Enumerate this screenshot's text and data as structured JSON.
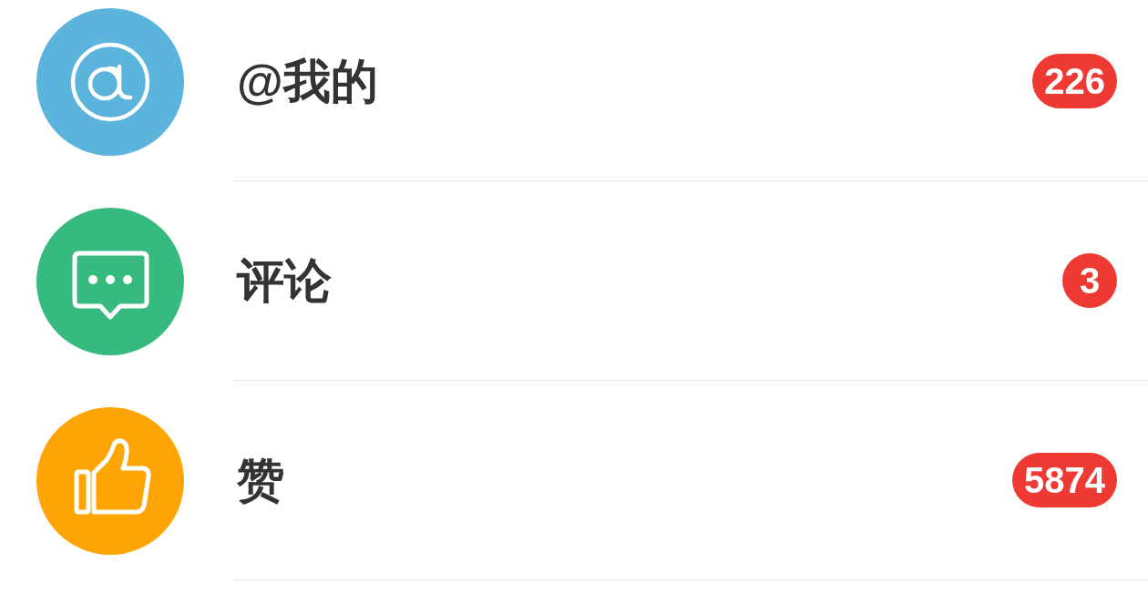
{
  "items": [
    {
      "kind": "mention",
      "label": "@我的",
      "badge": "226",
      "color": "#5bb4dc"
    },
    {
      "kind": "comment",
      "label": "评论",
      "badge": "3",
      "color": "#36ba7e"
    },
    {
      "kind": "like",
      "label": "赞",
      "badge": "5874",
      "color": "#fea405"
    }
  ]
}
